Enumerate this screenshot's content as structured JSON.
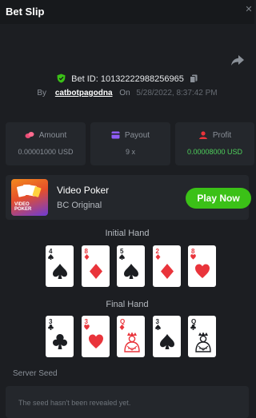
{
  "header": {
    "title": "Bet Slip",
    "close": "✕"
  },
  "bet": {
    "id_text": "Bet ID: 10132222988256965",
    "by_label": "By",
    "username": "catbotpagodna",
    "on_label": "On",
    "timestamp": "5/28/2022, 8:37:42 PM"
  },
  "stats": {
    "amount": {
      "label": "Amount",
      "value": "0.00001000 USD"
    },
    "payout": {
      "label": "Payout",
      "value": "9 x"
    },
    "profit": {
      "label": "Profit",
      "value": "0.00008000 USD"
    }
  },
  "game": {
    "name": "Video Poker",
    "subtitle": "BC Original",
    "thumb_text_1": "VIDEO",
    "thumb_text_2": "POKER",
    "play_label": "Play Now"
  },
  "initial_hand": {
    "title": "Initial Hand",
    "cards": [
      {
        "rank": "4",
        "suit": "spade"
      },
      {
        "rank": "8",
        "suit": "diamond"
      },
      {
        "rank": "5",
        "suit": "spade"
      },
      {
        "rank": "2",
        "suit": "diamond"
      },
      {
        "rank": "8",
        "suit": "heart"
      }
    ]
  },
  "final_hand": {
    "title": "Final Hand",
    "cards": [
      {
        "rank": "3",
        "suit": "club"
      },
      {
        "rank": "3",
        "suit": "heart"
      },
      {
        "rank": "Q",
        "suit": "diamond"
      },
      {
        "rank": "3",
        "suit": "spade"
      },
      {
        "rank": "Q",
        "suit": "club"
      }
    ]
  },
  "seed": {
    "title": "Server Seed",
    "text": "The seed hasn't been revealed yet."
  },
  "colors": {
    "accent_green": "#3bc117",
    "profit_green": "#4fd15c",
    "card_red": "#e9343b",
    "panel": "#24272c",
    "background": "#1c1e22"
  }
}
